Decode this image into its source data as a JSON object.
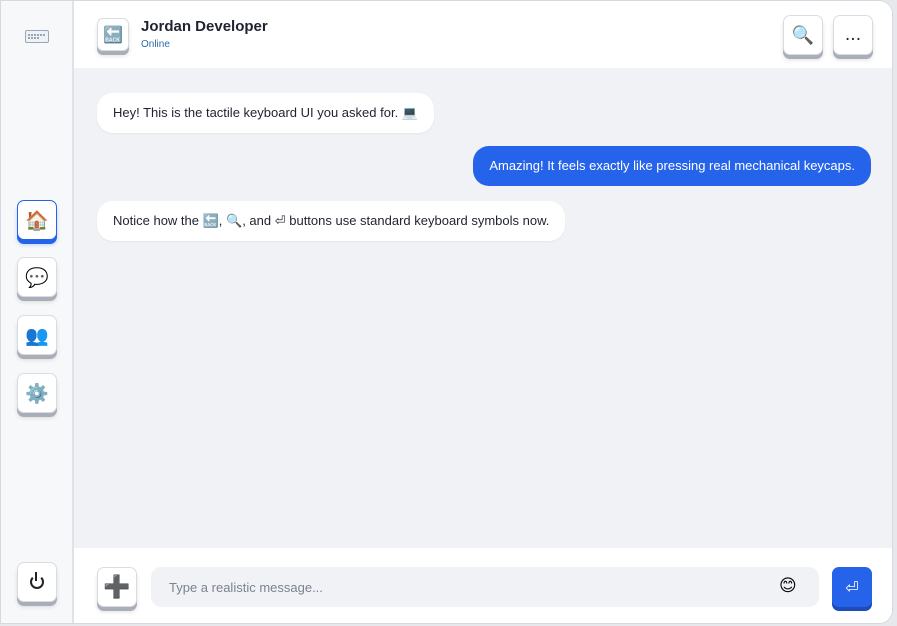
{
  "sidebar": {
    "logo_icon": "keyboard-icon",
    "nav": [
      {
        "icon": "home-icon",
        "glyph": "🏠",
        "active": true
      },
      {
        "icon": "chat-icon",
        "glyph": "💬",
        "active": false
      },
      {
        "icon": "users-icon",
        "glyph": "👥",
        "active": false
      },
      {
        "icon": "settings-icon",
        "glyph": "⚙️",
        "active": false
      }
    ],
    "power_icon": "power-icon"
  },
  "header": {
    "back_glyph": "🔙",
    "name": "Jordan Developer",
    "status": "Online",
    "search_glyph": "🔍",
    "more_glyph": "..."
  },
  "messages": [
    {
      "direction": "in",
      "text": "Hey! This is the tactile keyboard UI you asked for. 💻"
    },
    {
      "direction": "out",
      "text": "Amazing! It feels exactly like pressing real mechanical keycaps."
    },
    {
      "direction": "in",
      "text": "Notice how the 🔙, 🔍, and ⏎ buttons use standard keyboard symbols now."
    }
  ],
  "composer": {
    "add_glyph": "➕",
    "placeholder": "Type a realistic message...",
    "emoji_glyph": "😊",
    "send_glyph": "⏎"
  },
  "colors": {
    "accent": "#2563eb",
    "background": "#f0f2f6",
    "status": "#2e6ba8"
  }
}
